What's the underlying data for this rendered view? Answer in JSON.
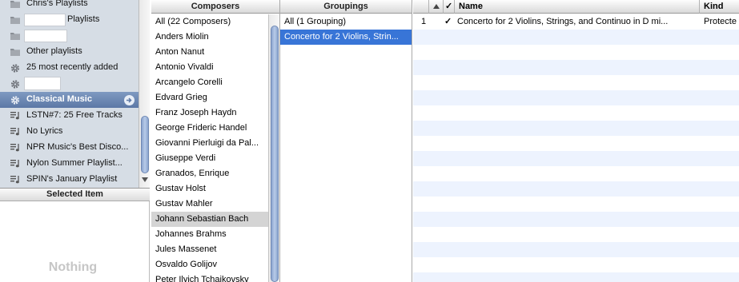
{
  "sidebar": {
    "items": [
      {
        "label": "Chris's Playlists",
        "icon": "folder-icon"
      },
      {
        "label": "Playlists",
        "icon": "folder-icon",
        "redacted": true
      },
      {
        "label": "",
        "icon": "folder-icon",
        "redacted": true
      },
      {
        "label": "Other playlists",
        "icon": "folder-icon"
      },
      {
        "label": "25 most recently added",
        "icon": "smart-playlist-gear-icon"
      },
      {
        "label": "",
        "icon": "smart-playlist-gear-icon",
        "redacted": true
      },
      {
        "label": "Classical Music",
        "icon": "smart-playlist-gear-icon",
        "selected": true
      },
      {
        "label": "LSTN#7: 25 Free Tracks",
        "icon": "playlist-icon"
      },
      {
        "label": "No Lyrics",
        "icon": "playlist-icon"
      },
      {
        "label": "NPR Music's Best Disco...",
        "icon": "playlist-icon"
      },
      {
        "label": "Nylon Summer Playlist...",
        "icon": "playlist-icon"
      },
      {
        "label": "SPIN's January Playlist",
        "icon": "playlist-icon"
      }
    ]
  },
  "selected_item": {
    "header": "Selected Item",
    "empty_text": "Nothing"
  },
  "composers": {
    "header": "Composers",
    "items": [
      "All (22 Composers)",
      "Anders Miolin",
      "Anton Nanut",
      "Antonio Vivaldi",
      "Arcangelo Corelli",
      "Edvard Grieg",
      "Franz Joseph Haydn",
      "George Frideric Handel",
      "Giovanni Pierluigi da Pal...",
      "Giuseppe Verdi",
      "Granados, Enrique",
      "Gustav Holst",
      "Gustav Mahler",
      "Johann Sebastian Bach",
      "Johannes Brahms",
      "Jules Massenet",
      "Osvaldo Golijov",
      "Peter Ilyich Tchaikovsky"
    ],
    "selected": "Johann Sebastian Bach"
  },
  "groupings": {
    "header": "Groupings",
    "items": [
      "All (1 Grouping)",
      "Concerto for 2 Violins, Strin..."
    ],
    "selected": "Concerto for 2 Violins, Strin..."
  },
  "tracks": {
    "columns": {
      "check": "✓",
      "name": "Name",
      "kind": "Kind"
    },
    "rows": [
      {
        "number": "1",
        "checked": "✓",
        "name": "Concerto for 2 Violins, Strings, and Continuo in D mi...",
        "kind": "Protecte"
      }
    ]
  },
  "colors": {
    "sidebar_bg": "#d6dde5",
    "selection_blue": "#3875d7",
    "stripe": "#edf3fe"
  }
}
